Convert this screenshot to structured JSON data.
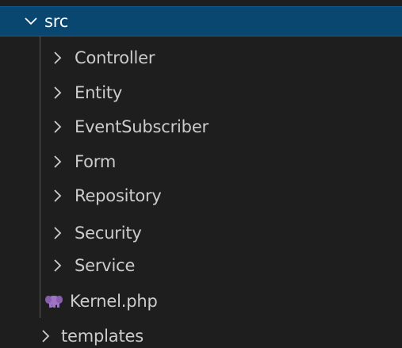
{
  "explorer": {
    "root": {
      "label": "src",
      "expanded": true
    },
    "children": [
      {
        "label": "Controller",
        "type": "folder",
        "expanded": false
      },
      {
        "label": "Entity",
        "type": "folder",
        "expanded": false
      },
      {
        "label": "EventSubscriber",
        "type": "folder",
        "expanded": false
      },
      {
        "label": "Form",
        "type": "folder",
        "expanded": false
      },
      {
        "label": "Repository",
        "type": "folder",
        "expanded": false
      },
      {
        "label": "Security",
        "type": "folder",
        "expanded": false
      },
      {
        "label": "Service",
        "type": "folder",
        "expanded": false
      },
      {
        "label": "Kernel.php",
        "type": "file",
        "icon": "php-elephant-icon"
      }
    ],
    "sibling": {
      "label": "templates",
      "expanded": false
    },
    "colors": {
      "background": "#1e1e1e",
      "selected_background": "#094771",
      "selected_border": "#0e639c",
      "text": "#cccccc",
      "php_icon": "#a074c4"
    }
  }
}
